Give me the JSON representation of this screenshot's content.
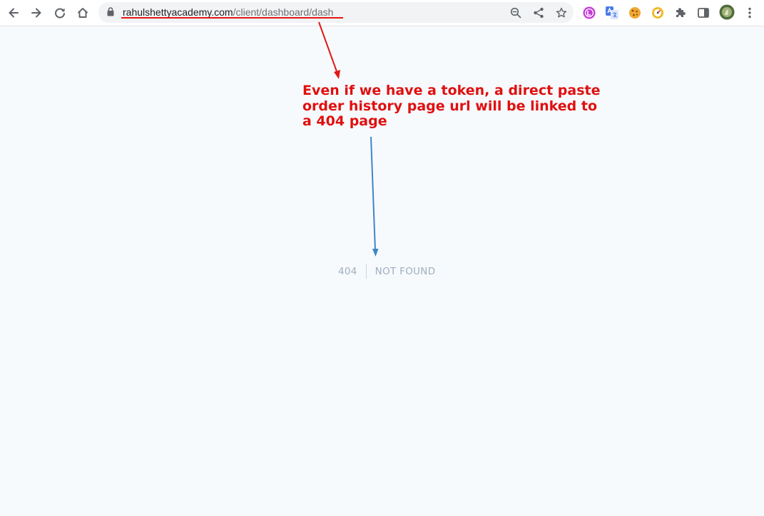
{
  "browser": {
    "url_host": "rahulshettyacademy.com",
    "url_path": "/client/dashboard/dash",
    "icons": {
      "back": "arrow-left-icon",
      "forward": "arrow-right-icon",
      "reload": "reload-icon",
      "home": "home-icon",
      "lock": "lock-icon",
      "zoom": "zoom-icon",
      "share": "share-icon",
      "bookmark": "star-icon",
      "extensions": "puzzle-icon",
      "side_panel": "side-panel-icon",
      "menu": "kebab-menu-icon"
    }
  },
  "annotation": {
    "lines": [
      "Even if we have a token, a direct paste",
      "order history page url will be linked to",
      "a 404 page"
    ],
    "color": "#e01010",
    "red_arrow_color": "#e41616",
    "blue_arrow_color": "#3f86c9"
  },
  "page": {
    "error_code": "404",
    "error_message": "NOT FOUND",
    "background": "#f7fafc",
    "text_color": "#a0aec0"
  }
}
